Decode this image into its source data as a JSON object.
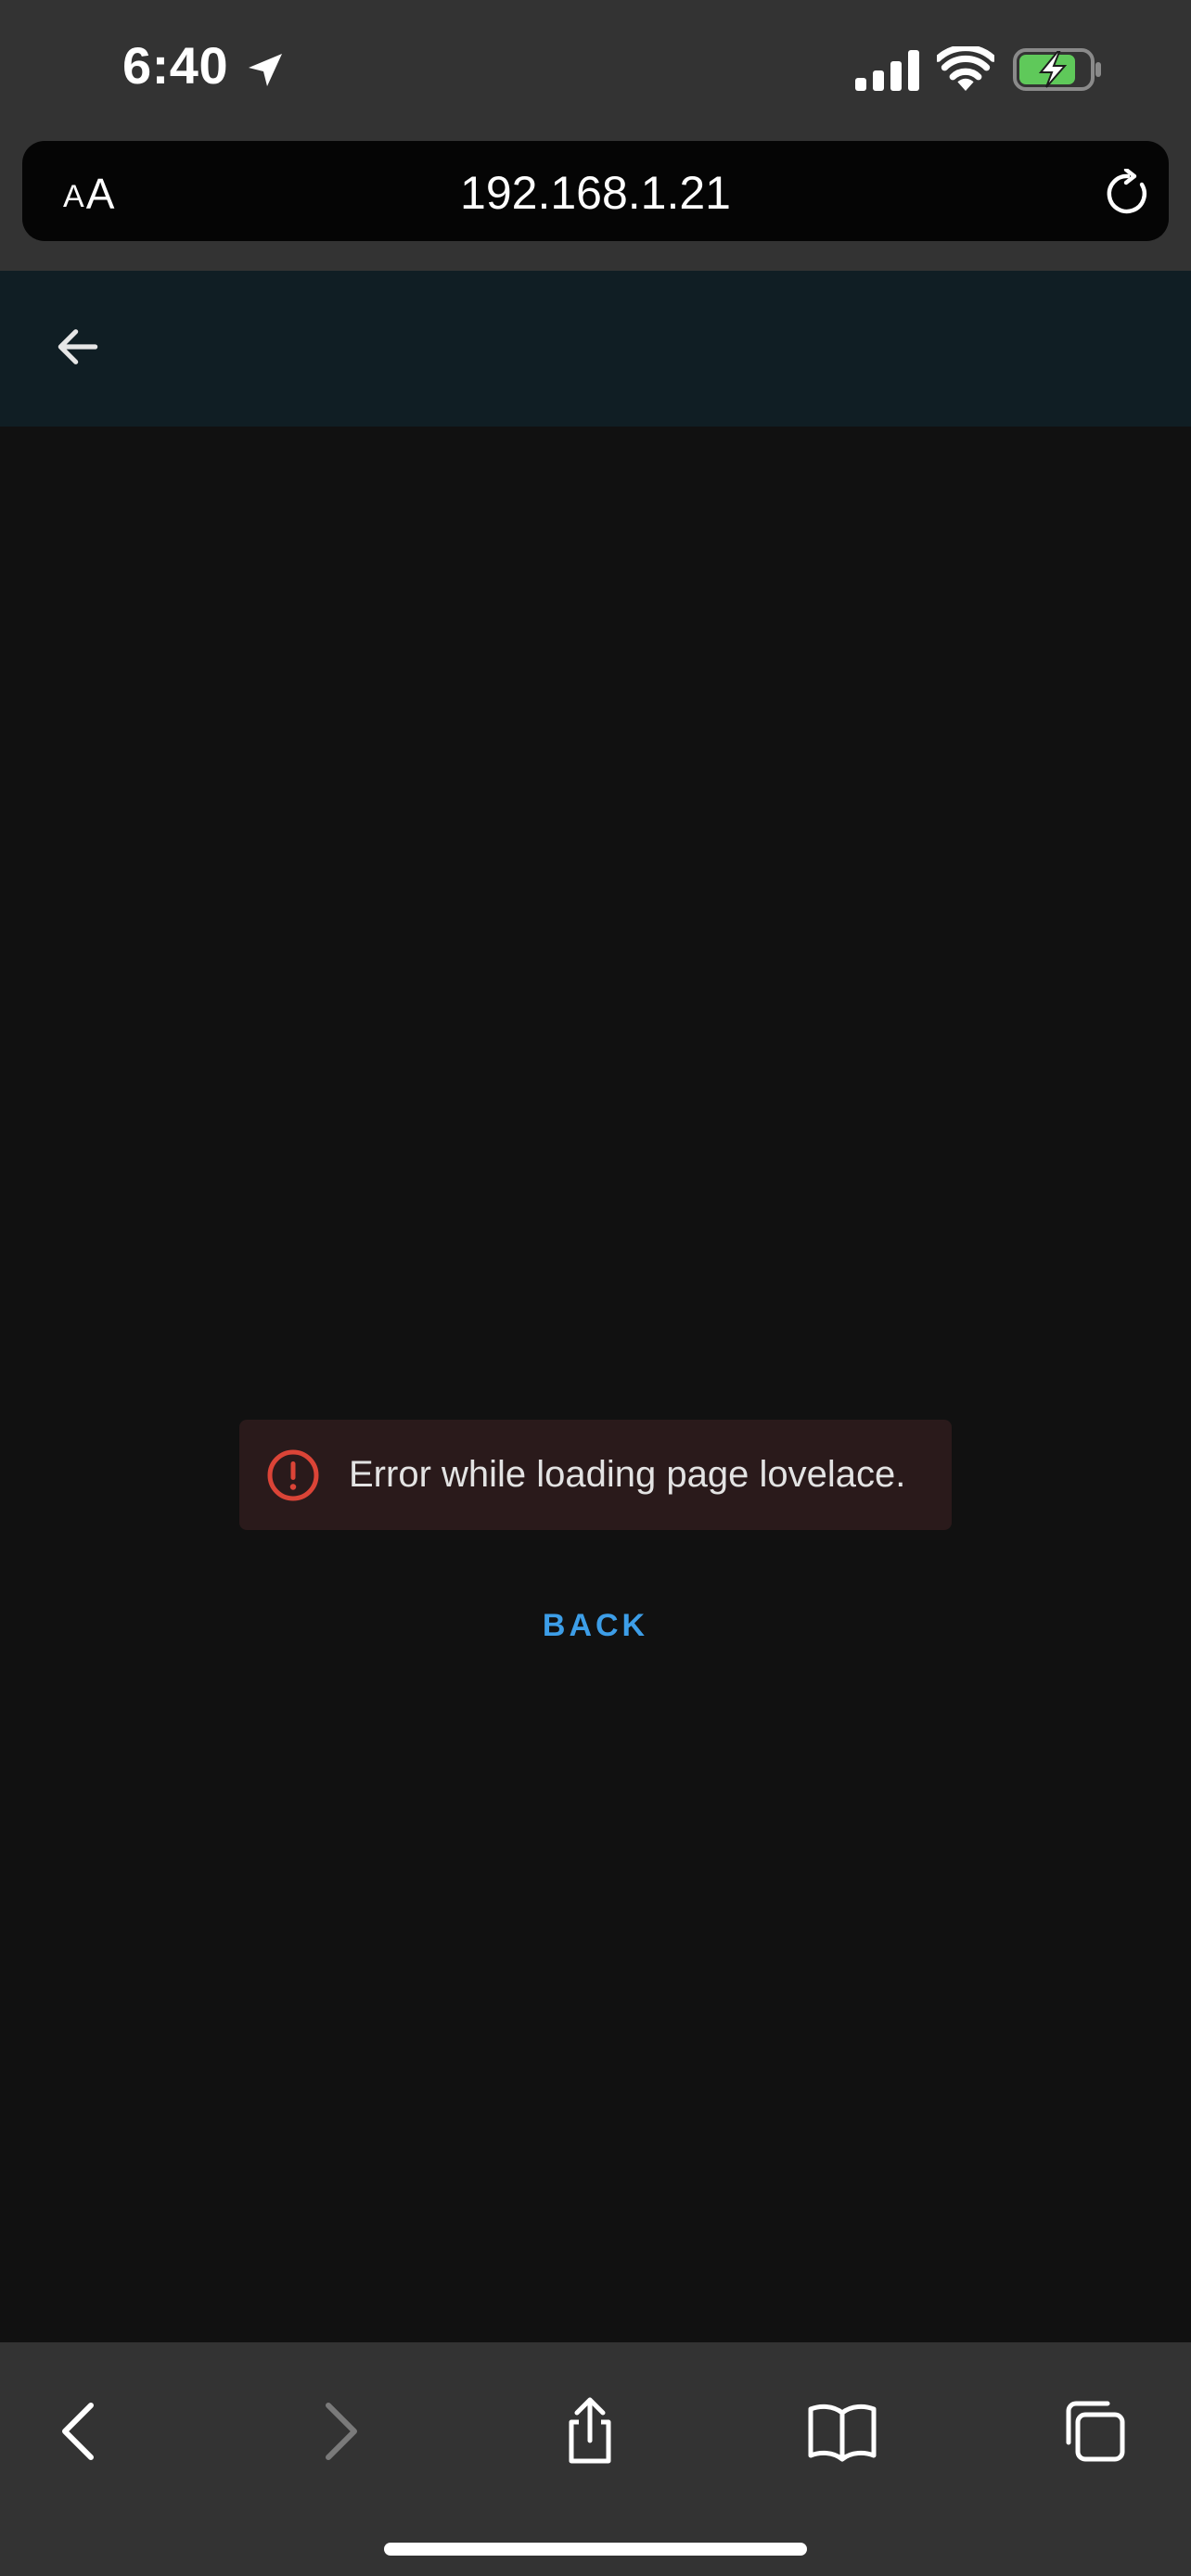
{
  "status_bar": {
    "time": "6:40",
    "icons": [
      "location-arrow-icon",
      "cellular-signal-icon",
      "wifi-icon",
      "battery-charging-icon"
    ],
    "battery_color": "#5fc95a"
  },
  "browser": {
    "reader_label_small": "A",
    "reader_label_large": "A",
    "url": "192.168.1.21",
    "reload_icon": "reload-icon"
  },
  "app_header": {
    "background": "#101e24",
    "back_icon": "arrow-left-icon"
  },
  "error": {
    "message": "Error while loading page lovelace.",
    "icon": "alert-circle-icon",
    "color": "#db4437"
  },
  "actions": {
    "back_label": "BACK",
    "accent": "#3d9ee8"
  },
  "toolbar": {
    "items": [
      "chevron-left-icon",
      "chevron-right-icon",
      "share-icon",
      "bookmarks-icon",
      "tabs-icon"
    ]
  }
}
